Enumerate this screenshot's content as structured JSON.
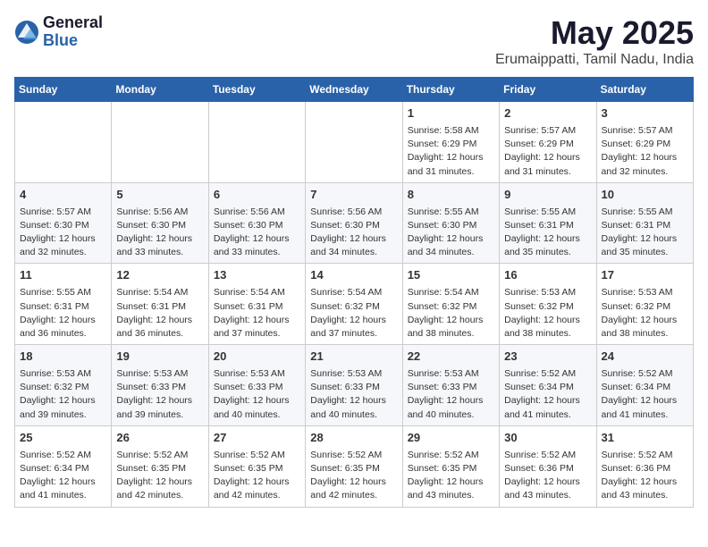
{
  "logo": {
    "general": "General",
    "blue": "Blue"
  },
  "title": "May 2025",
  "subtitle": "Erumaippatti, Tamil Nadu, India",
  "days_header": [
    "Sunday",
    "Monday",
    "Tuesday",
    "Wednesday",
    "Thursday",
    "Friday",
    "Saturday"
  ],
  "weeks": [
    [
      {
        "day": "",
        "info": ""
      },
      {
        "day": "",
        "info": ""
      },
      {
        "day": "",
        "info": ""
      },
      {
        "day": "",
        "info": ""
      },
      {
        "day": "1",
        "info": "Sunrise: 5:58 AM\nSunset: 6:29 PM\nDaylight: 12 hours\nand 31 minutes."
      },
      {
        "day": "2",
        "info": "Sunrise: 5:57 AM\nSunset: 6:29 PM\nDaylight: 12 hours\nand 31 minutes."
      },
      {
        "day": "3",
        "info": "Sunrise: 5:57 AM\nSunset: 6:29 PM\nDaylight: 12 hours\nand 32 minutes."
      }
    ],
    [
      {
        "day": "4",
        "info": "Sunrise: 5:57 AM\nSunset: 6:30 PM\nDaylight: 12 hours\nand 32 minutes."
      },
      {
        "day": "5",
        "info": "Sunrise: 5:56 AM\nSunset: 6:30 PM\nDaylight: 12 hours\nand 33 minutes."
      },
      {
        "day": "6",
        "info": "Sunrise: 5:56 AM\nSunset: 6:30 PM\nDaylight: 12 hours\nand 33 minutes."
      },
      {
        "day": "7",
        "info": "Sunrise: 5:56 AM\nSunset: 6:30 PM\nDaylight: 12 hours\nand 34 minutes."
      },
      {
        "day": "8",
        "info": "Sunrise: 5:55 AM\nSunset: 6:30 PM\nDaylight: 12 hours\nand 34 minutes."
      },
      {
        "day": "9",
        "info": "Sunrise: 5:55 AM\nSunset: 6:31 PM\nDaylight: 12 hours\nand 35 minutes."
      },
      {
        "day": "10",
        "info": "Sunrise: 5:55 AM\nSunset: 6:31 PM\nDaylight: 12 hours\nand 35 minutes."
      }
    ],
    [
      {
        "day": "11",
        "info": "Sunrise: 5:55 AM\nSunset: 6:31 PM\nDaylight: 12 hours\nand 36 minutes."
      },
      {
        "day": "12",
        "info": "Sunrise: 5:54 AM\nSunset: 6:31 PM\nDaylight: 12 hours\nand 36 minutes."
      },
      {
        "day": "13",
        "info": "Sunrise: 5:54 AM\nSunset: 6:31 PM\nDaylight: 12 hours\nand 37 minutes."
      },
      {
        "day": "14",
        "info": "Sunrise: 5:54 AM\nSunset: 6:32 PM\nDaylight: 12 hours\nand 37 minutes."
      },
      {
        "day": "15",
        "info": "Sunrise: 5:54 AM\nSunset: 6:32 PM\nDaylight: 12 hours\nand 38 minutes."
      },
      {
        "day": "16",
        "info": "Sunrise: 5:53 AM\nSunset: 6:32 PM\nDaylight: 12 hours\nand 38 minutes."
      },
      {
        "day": "17",
        "info": "Sunrise: 5:53 AM\nSunset: 6:32 PM\nDaylight: 12 hours\nand 38 minutes."
      }
    ],
    [
      {
        "day": "18",
        "info": "Sunrise: 5:53 AM\nSunset: 6:32 PM\nDaylight: 12 hours\nand 39 minutes."
      },
      {
        "day": "19",
        "info": "Sunrise: 5:53 AM\nSunset: 6:33 PM\nDaylight: 12 hours\nand 39 minutes."
      },
      {
        "day": "20",
        "info": "Sunrise: 5:53 AM\nSunset: 6:33 PM\nDaylight: 12 hours\nand 40 minutes."
      },
      {
        "day": "21",
        "info": "Sunrise: 5:53 AM\nSunset: 6:33 PM\nDaylight: 12 hours\nand 40 minutes."
      },
      {
        "day": "22",
        "info": "Sunrise: 5:53 AM\nSunset: 6:33 PM\nDaylight: 12 hours\nand 40 minutes."
      },
      {
        "day": "23",
        "info": "Sunrise: 5:52 AM\nSunset: 6:34 PM\nDaylight: 12 hours\nand 41 minutes."
      },
      {
        "day": "24",
        "info": "Sunrise: 5:52 AM\nSunset: 6:34 PM\nDaylight: 12 hours\nand 41 minutes."
      }
    ],
    [
      {
        "day": "25",
        "info": "Sunrise: 5:52 AM\nSunset: 6:34 PM\nDaylight: 12 hours\nand 41 minutes."
      },
      {
        "day": "26",
        "info": "Sunrise: 5:52 AM\nSunset: 6:35 PM\nDaylight: 12 hours\nand 42 minutes."
      },
      {
        "day": "27",
        "info": "Sunrise: 5:52 AM\nSunset: 6:35 PM\nDaylight: 12 hours\nand 42 minutes."
      },
      {
        "day": "28",
        "info": "Sunrise: 5:52 AM\nSunset: 6:35 PM\nDaylight: 12 hours\nand 42 minutes."
      },
      {
        "day": "29",
        "info": "Sunrise: 5:52 AM\nSunset: 6:35 PM\nDaylight: 12 hours\nand 43 minutes."
      },
      {
        "day": "30",
        "info": "Sunrise: 5:52 AM\nSunset: 6:36 PM\nDaylight: 12 hours\nand 43 minutes."
      },
      {
        "day": "31",
        "info": "Sunrise: 5:52 AM\nSunset: 6:36 PM\nDaylight: 12 hours\nand 43 minutes."
      }
    ]
  ]
}
